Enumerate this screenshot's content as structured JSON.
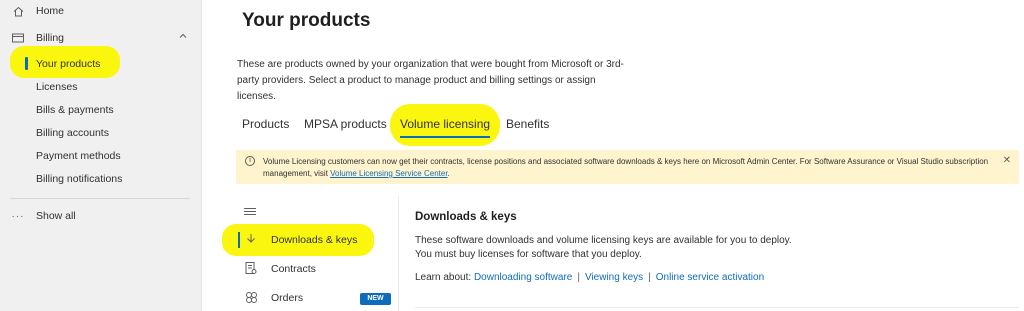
{
  "nav": {
    "home": "Home",
    "billing": "Billing",
    "sub_items": [
      "Your products",
      "Licenses",
      "Bills & payments",
      "Billing accounts",
      "Payment methods",
      "Billing notifications"
    ],
    "show_all": "Show all"
  },
  "page": {
    "title": "Your products",
    "description": "These are products owned by your organization that were bought from Microsoft or 3rd-party providers. Select a product to manage product and billing settings or assign licenses."
  },
  "tabs": [
    "Products",
    "MPSA products",
    "Volume licensing",
    "Benefits"
  ],
  "active_tab": "Volume licensing",
  "banner": {
    "text": "Volume Licensing customers can now get their contracts, license positions and associated software downloads & keys here on Microsoft Admin Center. For Software Assurance or Visual Studio subscription management, visit ",
    "link": "Volume Licensing Service Center",
    "suffix": "."
  },
  "inner_nav": {
    "items": [
      "Downloads & keys",
      "Contracts",
      "Orders"
    ],
    "badge": "NEW"
  },
  "section": {
    "title": "Downloads & keys",
    "line1": "These software downloads and volume licensing keys are available for you to deploy.",
    "line2": "You must buy licenses for software that you deploy.",
    "learn_label": "Learn about:",
    "links": [
      "Downloading software",
      "Viewing keys",
      "Online service activation"
    ]
  },
  "colors": {
    "accent": "#0f6cbd",
    "highlight": "#fbf500",
    "banner_bg": "#fff4ce"
  }
}
